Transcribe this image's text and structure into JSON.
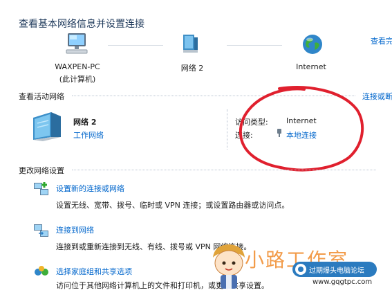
{
  "header": {
    "title": "查看基本网络信息并设置连接",
    "see_full_map": "查看完"
  },
  "map": {
    "pc_name": "WAXPEN-PC",
    "pc_sub": "(此计算机)",
    "network_name": "网络  2",
    "internet": "Internet"
  },
  "active": {
    "section_title": "查看活动网络",
    "connect_disconnect": "连接或断",
    "network_name": "网络  2",
    "network_type": "工作网络",
    "access_type_label": "访问类型:",
    "access_type_value": "Internet",
    "connection_label": "连接:",
    "connection_value": "本地连接"
  },
  "settings": {
    "section_title": "更改网络设置",
    "tasks": [
      {
        "title": "设置新的连接或网络",
        "desc": "设置无线、宽带、拨号、临时或 VPN 连接；或设置路由器或访问点。"
      },
      {
        "title": "连接到网络",
        "desc": "连接到或重新连接到无线、有线、拨号或 VPN 网络连接。"
      },
      {
        "title": "选择家庭组和共享选项",
        "desc": "访问位于其他网络计算机上的文件和打印机，或更改共享设置。"
      }
    ]
  },
  "watermark": {
    "text": "小路工作室",
    "badge": "过期爆头电脑论坛",
    "url": "www.gqgtpc.com"
  },
  "colors": {
    "link": "#0066cc",
    "title": "#1e395b",
    "annotation": "#e0202e"
  }
}
